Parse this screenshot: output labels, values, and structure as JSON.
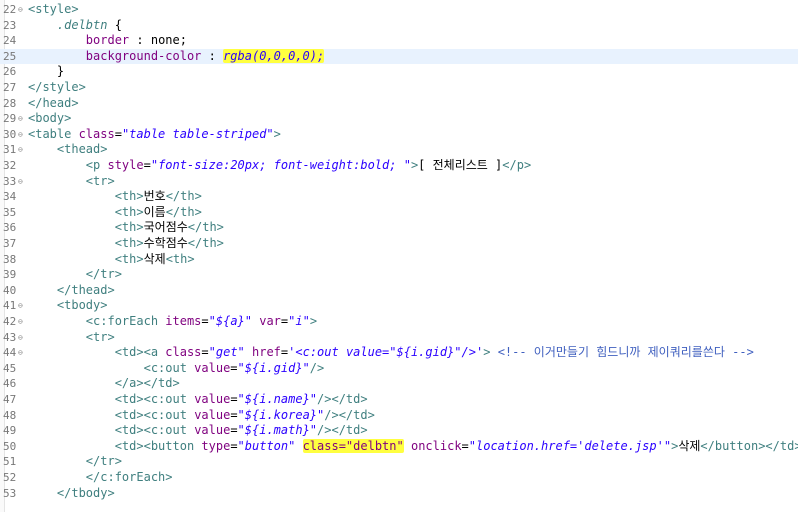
{
  "lines": [
    {
      "n": "22",
      "fold": true,
      "segs": [
        [
          "tag",
          "<style>"
        ]
      ]
    },
    {
      "n": "23",
      "fold": false,
      "segs": [
        [
          "txt",
          "    "
        ],
        [
          "css-sel",
          ".delbtn"
        ],
        [
          "txt",
          " {"
        ]
      ]
    },
    {
      "n": "24",
      "fold": false,
      "segs": [
        [
          "txt",
          "        "
        ],
        [
          "prop",
          "border"
        ],
        [
          "txt",
          " : "
        ],
        [
          "kw",
          "none"
        ],
        [
          "txt",
          ";"
        ]
      ]
    },
    {
      "n": "25",
      "fold": false,
      "current": true,
      "segs": [
        [
          "txt",
          "        "
        ],
        [
          "prop",
          "background-color"
        ],
        [
          "txt",
          " : "
        ],
        [
          "hlval",
          "rgba(0,0,0,0);"
        ]
      ]
    },
    {
      "n": "26",
      "fold": false,
      "segs": [
        [
          "txt",
          "    }"
        ]
      ]
    },
    {
      "n": "27",
      "fold": false,
      "segs": [
        [
          "tag",
          "</style>"
        ]
      ]
    },
    {
      "n": "28",
      "fold": false,
      "segs": [
        [
          "tag",
          "</head>"
        ]
      ]
    },
    {
      "n": "29",
      "fold": true,
      "segs": [
        [
          "tag",
          "<body>"
        ]
      ]
    },
    {
      "n": "30",
      "fold": true,
      "segs": [
        [
          "tag",
          "<table "
        ],
        [
          "attr",
          "class"
        ],
        [
          "txt",
          "="
        ],
        [
          "val",
          "\"table table-striped\""
        ],
        [
          "tag",
          ">"
        ]
      ]
    },
    {
      "n": "31",
      "fold": true,
      "segs": [
        [
          "txt",
          "    "
        ],
        [
          "tag",
          "<thead>"
        ]
      ]
    },
    {
      "n": "32",
      "fold": false,
      "segs": [
        [
          "txt",
          "        "
        ],
        [
          "tag",
          "<p "
        ],
        [
          "attr",
          "style"
        ],
        [
          "txt",
          "="
        ],
        [
          "val",
          "\"font-size:20px; font-weight:bold; \""
        ],
        [
          "tag",
          ">"
        ],
        [
          "txt",
          "[ 전체리스트 ]"
        ],
        [
          "tag",
          "</p>"
        ]
      ]
    },
    {
      "n": "33",
      "fold": true,
      "segs": [
        [
          "txt",
          "        "
        ],
        [
          "tag",
          "<tr>"
        ]
      ]
    },
    {
      "n": "34",
      "fold": false,
      "segs": [
        [
          "txt",
          "            "
        ],
        [
          "tag",
          "<th>"
        ],
        [
          "txt",
          "번호"
        ],
        [
          "tag",
          "</th>"
        ]
      ]
    },
    {
      "n": "35",
      "fold": false,
      "segs": [
        [
          "txt",
          "            "
        ],
        [
          "tag",
          "<th>"
        ],
        [
          "txt",
          "이름"
        ],
        [
          "tag",
          "</th>"
        ]
      ]
    },
    {
      "n": "36",
      "fold": false,
      "segs": [
        [
          "txt",
          "            "
        ],
        [
          "tag",
          "<th>"
        ],
        [
          "txt",
          "국어점수"
        ],
        [
          "tag",
          "</th>"
        ]
      ]
    },
    {
      "n": "37",
      "fold": false,
      "segs": [
        [
          "txt",
          "            "
        ],
        [
          "tag",
          "<th>"
        ],
        [
          "txt",
          "수학점수"
        ],
        [
          "tag",
          "</th>"
        ]
      ]
    },
    {
      "n": "38",
      "fold": false,
      "segs": [
        [
          "txt",
          "            "
        ],
        [
          "tag",
          "<th>"
        ],
        [
          "txt",
          "삭제"
        ],
        [
          "tag",
          "<th>"
        ]
      ]
    },
    {
      "n": "39",
      "fold": false,
      "segs": [
        [
          "txt",
          "        "
        ],
        [
          "tag",
          "</tr>"
        ]
      ]
    },
    {
      "n": "40",
      "fold": false,
      "segs": [
        [
          "txt",
          "    "
        ],
        [
          "tag",
          "</thead>"
        ]
      ]
    },
    {
      "n": "41",
      "fold": true,
      "segs": [
        [
          "txt",
          "    "
        ],
        [
          "tag",
          "<tbody>"
        ]
      ]
    },
    {
      "n": "42",
      "fold": true,
      "segs": [
        [
          "txt",
          "        "
        ],
        [
          "tag",
          "<c:forEach "
        ],
        [
          "attr",
          "items"
        ],
        [
          "txt",
          "="
        ],
        [
          "val",
          "\"${a}\""
        ],
        [
          "txt",
          " "
        ],
        [
          "attr",
          "var"
        ],
        [
          "txt",
          "="
        ],
        [
          "val",
          "\"i\""
        ],
        [
          "tag",
          ">"
        ]
      ]
    },
    {
      "n": "43",
      "fold": true,
      "segs": [
        [
          "txt",
          "        "
        ],
        [
          "tag",
          "<tr>"
        ]
      ]
    },
    {
      "n": "44",
      "fold": true,
      "segs": [
        [
          "txt",
          "            "
        ],
        [
          "tag",
          "<td><a "
        ],
        [
          "attr",
          "class"
        ],
        [
          "txt",
          "="
        ],
        [
          "val",
          "\"get\""
        ],
        [
          "txt",
          " "
        ],
        [
          "attr",
          "href"
        ],
        [
          "txt",
          "="
        ],
        [
          "val",
          "'<c:out value=\"${i.gid}\"/>'"
        ],
        [
          "tag",
          ">"
        ],
        [
          "txt",
          " "
        ],
        [
          "cmt",
          "<!-- 이거만들기 힘드니까 제이쿼리를쓴다 -->"
        ]
      ]
    },
    {
      "n": "45",
      "fold": false,
      "segs": [
        [
          "txt",
          "                "
        ],
        [
          "tag",
          "<c:out "
        ],
        [
          "attr",
          "value"
        ],
        [
          "txt",
          "="
        ],
        [
          "val",
          "\"${i.gid}\""
        ],
        [
          "tag",
          "/>"
        ]
      ]
    },
    {
      "n": "46",
      "fold": false,
      "segs": [
        [
          "txt",
          "            "
        ],
        [
          "tag",
          "</a></td>"
        ]
      ]
    },
    {
      "n": "47",
      "fold": false,
      "segs": [
        [
          "txt",
          "            "
        ],
        [
          "tag",
          "<td><c:out "
        ],
        [
          "attr",
          "value"
        ],
        [
          "txt",
          "="
        ],
        [
          "val",
          "\"${i.name}\""
        ],
        [
          "tag",
          "/></td>"
        ]
      ]
    },
    {
      "n": "48",
      "fold": false,
      "segs": [
        [
          "txt",
          "            "
        ],
        [
          "tag",
          "<td><c:out "
        ],
        [
          "attr",
          "value"
        ],
        [
          "txt",
          "="
        ],
        [
          "val",
          "\"${i.korea}\""
        ],
        [
          "tag",
          "/></td>"
        ]
      ]
    },
    {
      "n": "49",
      "fold": false,
      "segs": [
        [
          "txt",
          "            "
        ],
        [
          "tag",
          "<td><c:out "
        ],
        [
          "attr",
          "value"
        ],
        [
          "txt",
          "="
        ],
        [
          "val",
          "\"${i.math}\""
        ],
        [
          "tag",
          "/></td>"
        ]
      ]
    },
    {
      "n": "50",
      "fold": false,
      "segs": [
        [
          "txt",
          "            "
        ],
        [
          "tag",
          "<td><button "
        ],
        [
          "attr",
          "type"
        ],
        [
          "txt",
          "="
        ],
        [
          "val",
          "\"button\""
        ],
        [
          "txt",
          " "
        ],
        [
          "hlattr",
          "class=\"delbtn\""
        ],
        [
          "txt",
          " "
        ],
        [
          "attr",
          "onclick"
        ],
        [
          "txt",
          "="
        ],
        [
          "val",
          "\"location.href='delete.jsp'\""
        ],
        [
          "tag",
          ">"
        ],
        [
          "txt",
          "삭제"
        ],
        [
          "tag",
          "</button></td>"
        ]
      ]
    },
    {
      "n": "51",
      "fold": false,
      "segs": [
        [
          "txt",
          "        "
        ],
        [
          "tag",
          "</tr>"
        ]
      ]
    },
    {
      "n": "52",
      "fold": false,
      "segs": [
        [
          "txt",
          "        "
        ],
        [
          "tag",
          "</c:forEach>"
        ]
      ]
    },
    {
      "n": "53",
      "fold": false,
      "segs": [
        [
          "txt",
          "    "
        ],
        [
          "tag",
          "</tbody>"
        ]
      ]
    }
  ],
  "icons": {
    "fold": "minus-circle-icon",
    "warn_line": "32"
  }
}
